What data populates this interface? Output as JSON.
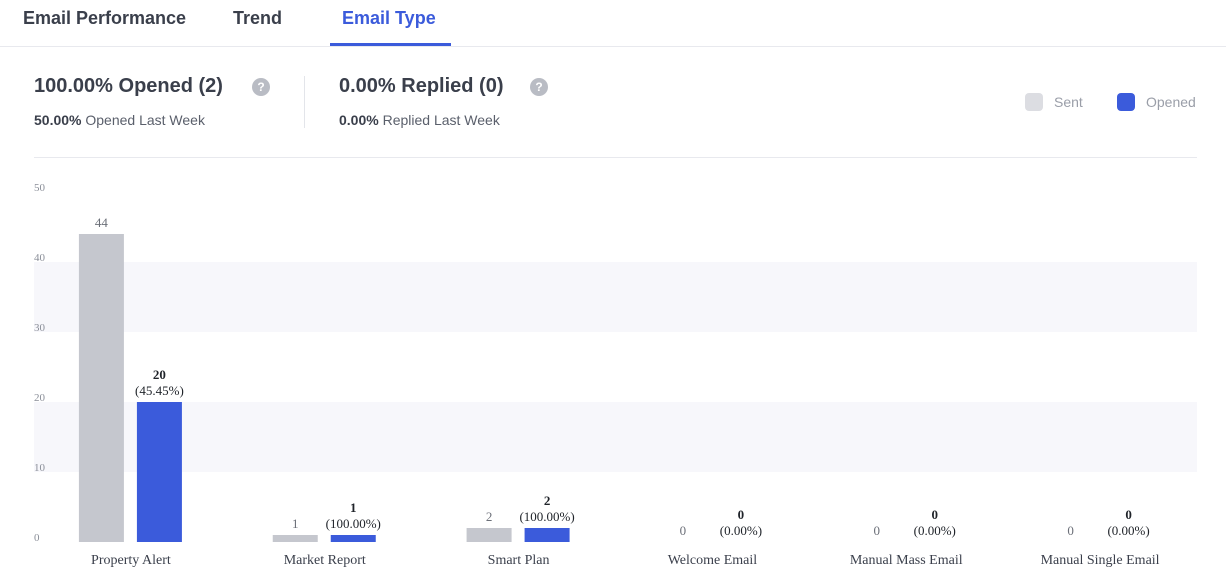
{
  "tabs": [
    {
      "label": "Email Performance",
      "active": false
    },
    {
      "label": "Trend",
      "active": false
    },
    {
      "label": "Email Type",
      "active": true
    }
  ],
  "stats": {
    "opened": {
      "main": "100.00% Opened (2)",
      "sub_value": "50.00%",
      "sub_label": "Opened Last Week"
    },
    "replied": {
      "main": "0.00% Replied (0)",
      "sub_value": "0.00%",
      "sub_label": "Replied Last Week"
    },
    "help_glyph": "?"
  },
  "legend": [
    {
      "label": "Sent",
      "color": "#dcdde2"
    },
    {
      "label": "Opened",
      "color": "#3b5bdb"
    }
  ],
  "colors": {
    "sent_bar": "#c5c7ce",
    "opened_bar": "#3b5bdb",
    "band": "#f7f7fb",
    "accent": "#3b5bdb"
  },
  "chart_data": {
    "type": "bar",
    "ylim": [
      0,
      50
    ],
    "yticks": [
      0,
      10,
      20,
      30,
      40,
      50
    ],
    "categories": [
      "Property Alert",
      "Market Report",
      "Smart Plan",
      "Welcome Email",
      "Manual Mass Email",
      "Manual Single Email"
    ],
    "series": [
      {
        "name": "Sent",
        "values": [
          44,
          1,
          2,
          0,
          0,
          0
        ]
      },
      {
        "name": "Opened",
        "values": [
          20,
          1,
          2,
          0,
          0,
          0
        ],
        "percent_labels": [
          "(45.45%)",
          "(100.00%)",
          "(100.00%)",
          "(0.00%)",
          "(0.00%)",
          "(0.00%)"
        ]
      }
    ]
  }
}
